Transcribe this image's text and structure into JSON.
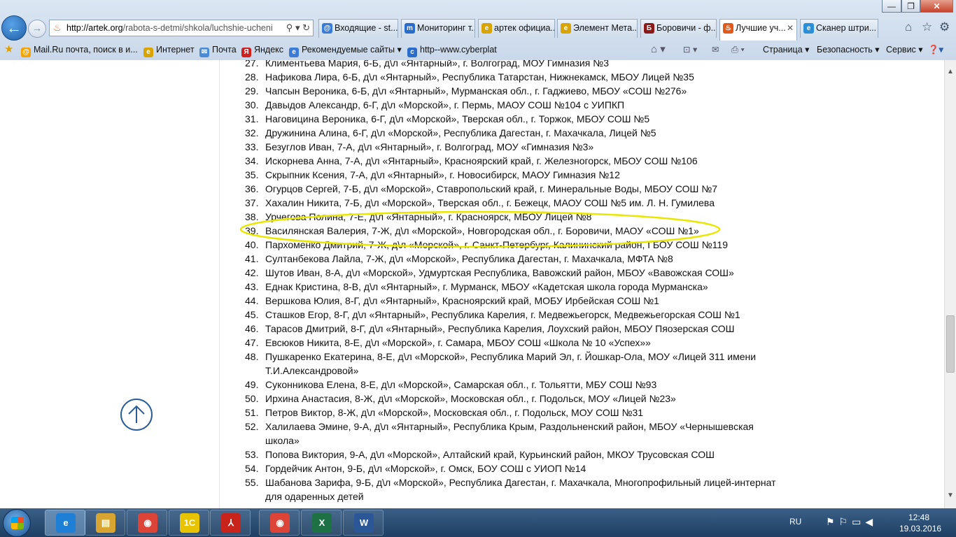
{
  "browser": {
    "address_host": "http://artek.org",
    "address_path": "/rabota-s-detmi/shkola/luchshie-ucheni",
    "tabs": [
      {
        "label": "Входящие - st...",
        "color": "#3a7bd5",
        "glyph": "@"
      },
      {
        "label": "Мониторинг т...",
        "color": "#2a6cc9",
        "glyph": "m"
      },
      {
        "label": "артек официа...",
        "color": "#d9a400",
        "glyph": "e"
      },
      {
        "label": "Элемент Мета...",
        "color": "#d9a400",
        "glyph": "e"
      },
      {
        "label": "Боровичи - ф...",
        "color": "#8b1a1a",
        "glyph": "Б"
      },
      {
        "label": "Лучшие уч...",
        "color": "#e05a1b",
        "glyph": "♨"
      },
      {
        "label": "Сканер штри...",
        "color": "#2a8fd6",
        "glyph": "e"
      }
    ],
    "favorites": [
      {
        "label": "Mail.Ru почта, поиск в и...",
        "color": "#f5a300",
        "glyph": "@"
      },
      {
        "label": "Интернет",
        "color": "#d9a400",
        "glyph": "e"
      },
      {
        "label": "Почта",
        "color": "#4a8bd6",
        "glyph": "✉"
      },
      {
        "label": "Яндекс",
        "color": "#d02020",
        "glyph": "Я"
      },
      {
        "label": "Рекомендуемые сайты ▾",
        "color": "#3a7bd5",
        "glyph": "e"
      },
      {
        "label": "http--www.cyberplat",
        "color": "#2a6cc9",
        "glyph": "c"
      }
    ],
    "commands": [
      "Страница ▾",
      "Безопасность ▾",
      "Сервис ▾"
    ]
  },
  "students": [
    {
      "num": "27.",
      "text": "Климентьева Мария, 6-Б, д\\л «Янтарный», г. Волгоград, МОУ Гимназия №3"
    },
    {
      "num": "28.",
      "text": "Нафикова Лира, 6-Б, д\\л «Янтарный», Республика Татарстан, Нижнекамск, МБОУ Лицей №35"
    },
    {
      "num": "29.",
      "text": "Чапсын Вероника, 6-Б, д\\л «Янтарный», Мурманская обл., г. Гаджиево, МБОУ «СОШ №276»"
    },
    {
      "num": "30.",
      "text": "Давыдов Александр, 6-Г, д\\л «Морской», г. Пермь, МАОУ СОШ №104 с УИПКП"
    },
    {
      "num": "31.",
      "text": "Наговицина Вероника, 6-Г, д\\л «Морской», Тверская обл., г. Торжок, МБОУ СОШ №5"
    },
    {
      "num": "32.",
      "text": "Дружинина Алина, 6-Г, д\\л «Морской», Республика Дагестан, г. Махачкала, Лицей №5"
    },
    {
      "num": "33.",
      "text": "Безуглов Иван, 7-А, д\\л «Янтарный», г. Волгоград, МОУ «Гимназия №3»"
    },
    {
      "num": "34.",
      "text": "Искорнева Анна, 7-А, д\\л «Янтарный», Красноярский край, г. Железногорск, МБОУ СОШ №106"
    },
    {
      "num": "35.",
      "text": "Скрыпник Ксения, 7-А, д\\л «Янтарный», г. Новосибирск, МАОУ Гимназия №12"
    },
    {
      "num": "36.",
      "text": "Огурцов Сергей, 7-Б, д\\л «Морской», Ставропольский край, г. Минеральные Воды, МБОУ СОШ №7"
    },
    {
      "num": "37.",
      "text": "Хахалин Никита, 7-Б, д\\л «Морской», Тверская обл., г. Бежецк, МАОУ СОШ №5 им. Л. Н. Гумилева"
    },
    {
      "num": "38.",
      "text": "Урчегова Полина, 7-Е, д\\л «Янтарный», г. Красноярск, МБОУ Лицей №8"
    },
    {
      "num": "39.",
      "text": "Василянская Валерия, 7-Ж, д\\л «Морской», Новгородская обл., г. Боровичи, МАОУ «СОШ №1»"
    },
    {
      "num": "40.",
      "text": "Пархоменко Дмитрий, 7-Ж, д\\л «Морской», г. Санкт-Петербург, Калининский район, ГБОУ СОШ №119"
    },
    {
      "num": "41.",
      "text": "Султанбекова Лайла, 7-Ж, д\\л «Морской», Республика Дагестан, г. Махачкала, МФТА №8"
    },
    {
      "num": "42.",
      "text": "Шутов Иван, 8-А, д\\л «Морской», Удмуртская Республика, Вавожский район, МБОУ «Вавожская СОШ»"
    },
    {
      "num": "43.",
      "text": "Еднак Кристина, 8-В, д\\л «Янтарный», г. Мурманск, МБОУ «Кадетская школа города Мурманска»"
    },
    {
      "num": "44.",
      "text": "Вершкова Юлия, 8-Г, д\\л «Янтарный», Красноярский край, МОБУ Ирбейская СОШ №1"
    },
    {
      "num": "45.",
      "text": "Сташков Егор, 8-Г, д\\л «Янтарный», Республика Карелия, г. Медвежьегорск, Медвежьегорская СОШ №1"
    },
    {
      "num": "46.",
      "text": "Тарасов Дмитрий, 8-Г, д\\л «Янтарный», Республика Карелия, Лоухский район, МБОУ Пяозерская СОШ"
    },
    {
      "num": "47.",
      "text": "Евсюков Никита, 8-Е, д\\л «Морской», г. Самара, МБОУ СОШ «Школа № 10 «Успех»»"
    },
    {
      "num": "48.",
      "text": "Пушкаренко Екатерина, 8-Е, д\\л «Морской», Республика Марий Эл, г. Йошкар-Ола, МОУ «Лицей 311 имени Т.И.Александровой»"
    },
    {
      "num": "49.",
      "text": "Суконникова Елена, 8-Е, д\\л «Морской», Самарская обл., г. Тольятти, МБУ СОШ №93"
    },
    {
      "num": "50.",
      "text": "Ирхина Анастасия, 8-Ж, д\\л «Морской», Московская обл., г. Подольск, МОУ «Лицей №23»"
    },
    {
      "num": "51.",
      "text": "Петров Виктор, 8-Ж, д\\л «Морской», Московская обл., г. Подольск, МОУ СОШ №31"
    },
    {
      "num": "52.",
      "text": "Халилаева Эмине, 9-А, д\\л «Янтарный», Республика Крым, Раздольненский район, МБОУ «Чернышевская школа»"
    },
    {
      "num": "53.",
      "text": "Попова Виктория, 9-А, д\\л «Морской», Алтайский край, Курьинский район, МКОУ Трусовская СОШ"
    },
    {
      "num": "54.",
      "text": "Гордейчик Антон, 9-Б, д\\л «Морской», г. Омск, БОУ СОШ с УИОП №14"
    },
    {
      "num": "55.",
      "text": "Шабанова Зарифа, 9-Б, д\\л «Морской», Республика Дагестан, г. Махачкала, Многопрофильный лицей-интернат для одаренных детей"
    }
  ],
  "highlight_color": "#e9e600",
  "taskbar": {
    "apps": [
      {
        "glyph": "",
        "color": "#ffffff"
      },
      {
        "glyph": "e",
        "color": "#1e7fd6"
      },
      {
        "glyph": "▤",
        "color": "#d8a533"
      },
      {
        "glyph": "◉",
        "color": "#db4437"
      },
      {
        "glyph": "1С",
        "color": "#e8c300"
      },
      {
        "glyph": "⅄",
        "color": "#c9241c"
      },
      {
        "glyph": "◉",
        "color": "#db4437"
      },
      {
        "glyph": "X",
        "color": "#1e7145"
      },
      {
        "glyph": "W",
        "color": "#2b5797"
      }
    ],
    "lang": "RU",
    "time": "12:48",
    "date": "19.03.2016"
  }
}
